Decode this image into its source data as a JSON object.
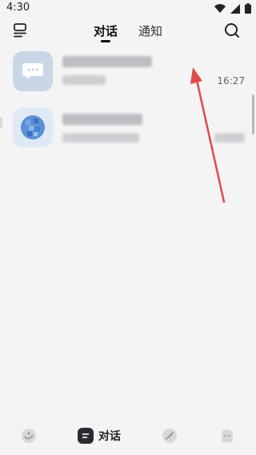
{
  "status_bar": {
    "time": "4:30"
  },
  "header": {
    "tabs": [
      {
        "label": "对话",
        "active": true
      },
      {
        "label": "通知",
        "active": false
      }
    ]
  },
  "conversations": [
    {
      "time": "16:27",
      "avatar": "chat-bubble-icon"
    },
    {
      "time": "",
      "avatar": "pixel-avatar-icon"
    }
  ],
  "bottom_nav": {
    "items": [
      {
        "icon": "discover-icon"
      },
      {
        "icon": "chat-icon",
        "label": "对话",
        "active": true
      },
      {
        "icon": "feather-icon"
      },
      {
        "icon": "profile-face-icon"
      }
    ]
  },
  "colors": {
    "background": "#f4f4f5",
    "annotation_arrow": "#e24a4a",
    "active_tab": "#111111"
  }
}
